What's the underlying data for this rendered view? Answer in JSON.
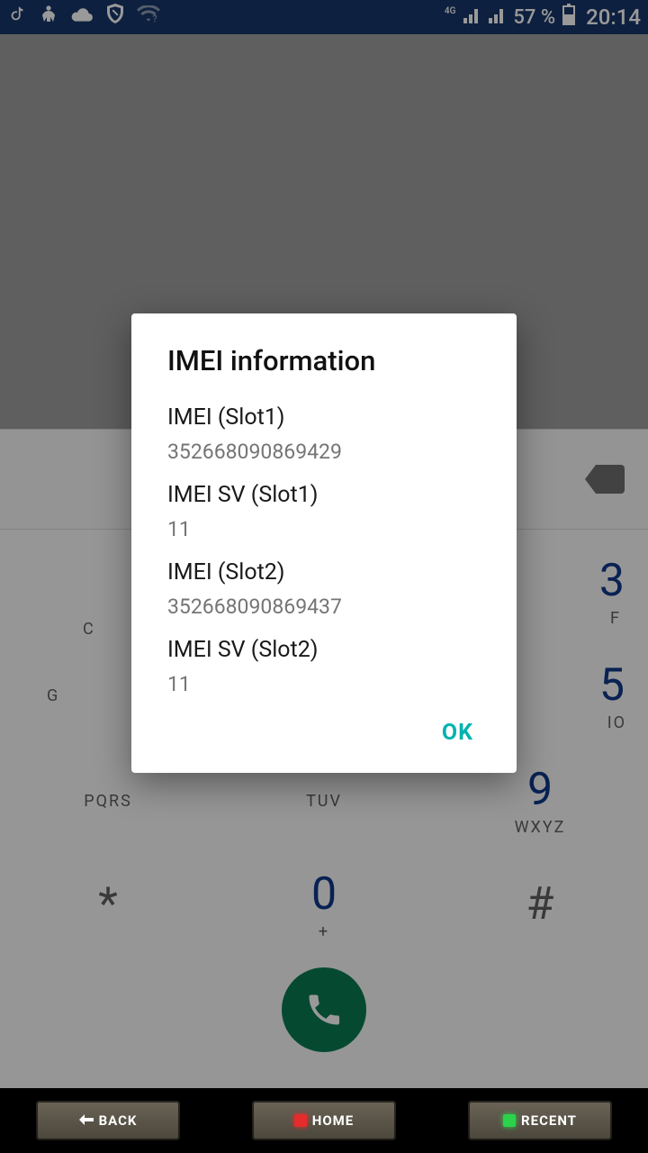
{
  "status": {
    "network_label": "4G",
    "battery_pct": "57 %",
    "clock": "20:14"
  },
  "dialog": {
    "title": "IMEI information",
    "items": [
      {
        "label": "IMEI (Slot1)",
        "value": "352668090869429"
      },
      {
        "label": "IMEI SV (Slot1)",
        "value": "11"
      },
      {
        "label": "IMEI (Slot2)",
        "value": "352668090869437"
      },
      {
        "label": "IMEI SV (Slot2)",
        "value": "11"
      }
    ],
    "ok_label": "OK"
  },
  "keypad": {
    "row3": [
      {
        "digit": "",
        "letters": "PQRS"
      },
      {
        "digit": "",
        "letters": "TUV"
      },
      {
        "digit": "",
        "letters": "WXYZ"
      }
    ],
    "row4": [
      {
        "digit": "*",
        "letters": ""
      },
      {
        "digit": "0",
        "letters": "+"
      },
      {
        "digit": "#",
        "letters": ""
      }
    ],
    "partial": {
      "g": "G",
      "io": "IO",
      "f_right": "F",
      "c_left": "C",
      "three": "3",
      "five": "5",
      "nine": "9"
    }
  },
  "softkeys": {
    "back": "BACK",
    "home": "HOME",
    "recent": "RECENT"
  }
}
